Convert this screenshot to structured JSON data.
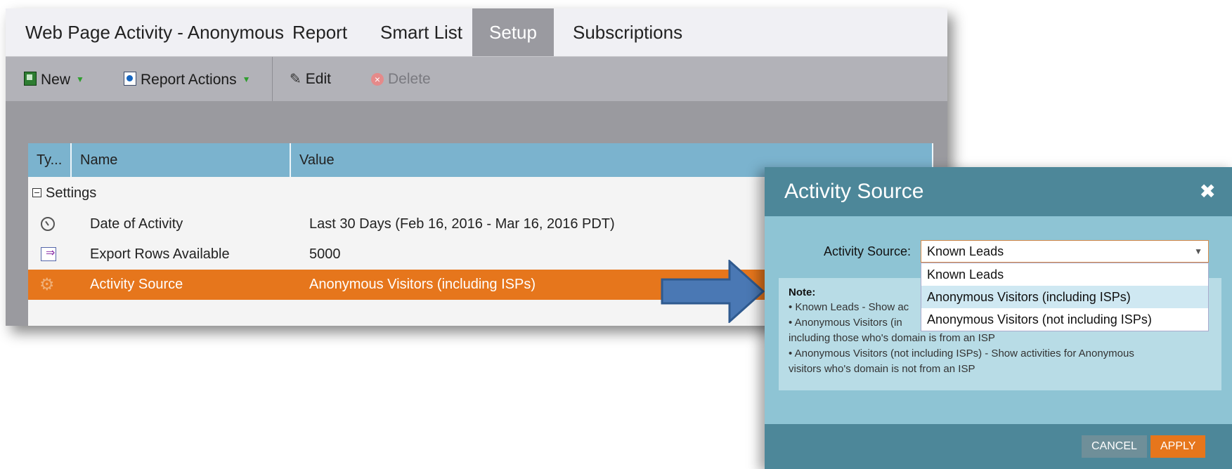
{
  "tabs": [
    {
      "label": "Web Page Activity - Anonymous",
      "active": false
    },
    {
      "label": "Report",
      "active": false
    },
    {
      "label": "Smart List",
      "active": false
    },
    {
      "label": "Setup",
      "active": true
    },
    {
      "label": "Subscriptions",
      "active": false
    }
  ],
  "toolbar": {
    "new_label": "New",
    "report_actions_label": "Report Actions",
    "edit_label": "Edit",
    "delete_label": "Delete"
  },
  "grid": {
    "headers": [
      "Ty...",
      "Name",
      "Value"
    ],
    "group_label": "Settings",
    "rows": [
      {
        "icon": "clock-icon",
        "name": "Date of Activity",
        "value": "Last 30 Days (Feb 16, 2016 - Mar 16, 2016 PDT)"
      },
      {
        "icon": "export-rows-icon",
        "name": "Export Rows Available",
        "value": "5000"
      },
      {
        "icon": "gear-icon",
        "name": "Activity Source",
        "value": "Anonymous Visitors (including ISPs)",
        "selected": true
      }
    ]
  },
  "dialog": {
    "title": "Activity Source",
    "field_label": "Activity Source:",
    "selected_value": "Known Leads",
    "options": [
      "Known Leads",
      "Anonymous Visitors (including ISPs)",
      "Anonymous Visitors (not including ISPs)"
    ],
    "highlighted_option": "Anonymous Visitors (including ISPs)",
    "note_title": "Note:",
    "note_lines": [
      "• Known Leads - Show ac",
      "• Anonymous Visitors (in",
      "including those who's domain is from an ISP",
      "• Anonymous Visitors (not including ISPs) - Show activities for Anonymous",
      "visitors who's domain is not from an ISP"
    ],
    "cancel_label": "CANCEL",
    "apply_label": "APPLY"
  },
  "colors": {
    "accent_orange": "#e6761c",
    "header_blue": "#7bb3ce",
    "dialog_teal": "#4d8799",
    "dialog_body": "#8ec4d4",
    "arrow_blue": "#4a78b4"
  }
}
